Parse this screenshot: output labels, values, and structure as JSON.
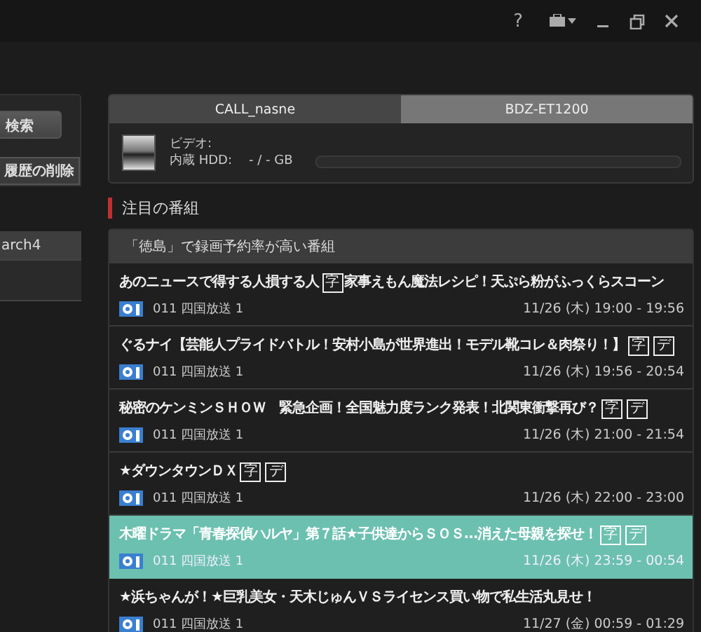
{
  "toolbar": {
    "help": "?"
  },
  "sidebar": {
    "search_button": "検索",
    "clear_history_button": "履歴の削除",
    "items": [
      {
        "label": "arch4",
        "selected": true
      },
      {
        "selected": false
      }
    ]
  },
  "devices": {
    "tabs": [
      {
        "label": "CALL_nasne",
        "selected": true
      },
      {
        "label": "BDZ-ET1200",
        "selected": false
      }
    ],
    "video_label": "ビデオ:",
    "hdd_label": "内蔵 HDD:",
    "hdd_value": "- / - GB",
    "level": 0
  },
  "featured": {
    "heading": "注目の番組",
    "list_title": "「徳島」で録画予約率が高い番組",
    "programs": [
      {
        "title": [
          {
            "kind": "text",
            "text": "あのニュースで得する人損する人"
          },
          {
            "kind": "mark",
            "text": "字"
          },
          {
            "kind": "text",
            "text": "家事えもん魔法レシピ！天ぷら粉がふっくらスコーン"
          }
        ],
        "channel": "011  四国放送 1",
        "time": "11/26 (木) 19:00  -  19:56",
        "selected": false
      },
      {
        "title": [
          {
            "kind": "text",
            "text": "ぐるナイ【芸能人プライドバトル！安村小島が世界進出！モデル靴コレ＆肉祭り！】"
          },
          {
            "kind": "mark",
            "text": "字"
          },
          {
            "kind": "mark",
            "text": "デ"
          }
        ],
        "channel": "011  四国放送 1",
        "time": "11/26 (木) 19:56  -  20:54",
        "selected": false
      },
      {
        "title": [
          {
            "kind": "text",
            "text": "秘密のケンミンＳＨＯＷ　緊急企画！全国魅力度ランク発表！北関東衝撃再び？"
          },
          {
            "kind": "mark",
            "text": "字"
          },
          {
            "kind": "mark",
            "text": "デ"
          }
        ],
        "channel": "011  四国放送 1",
        "time": "11/26 (木) 21:00  -  21:54",
        "selected": false
      },
      {
        "title": [
          {
            "kind": "text",
            "text": "★ダウンタウンＤＸ"
          },
          {
            "kind": "mark",
            "text": "字"
          },
          {
            "kind": "mark",
            "text": "デ"
          }
        ],
        "channel": "011  四国放送 1",
        "time": "11/26 (木) 22:00  -  23:00",
        "selected": false
      },
      {
        "title": [
          {
            "kind": "text",
            "text": "木曜ドラマ「青春探偵ハルヤ」第７話★子供達からＳＯＳ…消えた母親を探せ！"
          },
          {
            "kind": "mark",
            "text": "字"
          },
          {
            "kind": "mark",
            "text": "デ"
          }
        ],
        "channel": "011  四国放送 1",
        "time": "11/26 (木) 23:59  -  00:54",
        "selected": true
      },
      {
        "title": [
          {
            "kind": "text",
            "text": "★浜ちゃんが！★巨乳美女・天木じゅんＶＳライセンス買い物で私生活丸見せ！"
          }
        ],
        "channel": "011  四国放送 1",
        "time": "11/27 (金) 00:59  -  01:29",
        "selected": false
      }
    ]
  }
}
